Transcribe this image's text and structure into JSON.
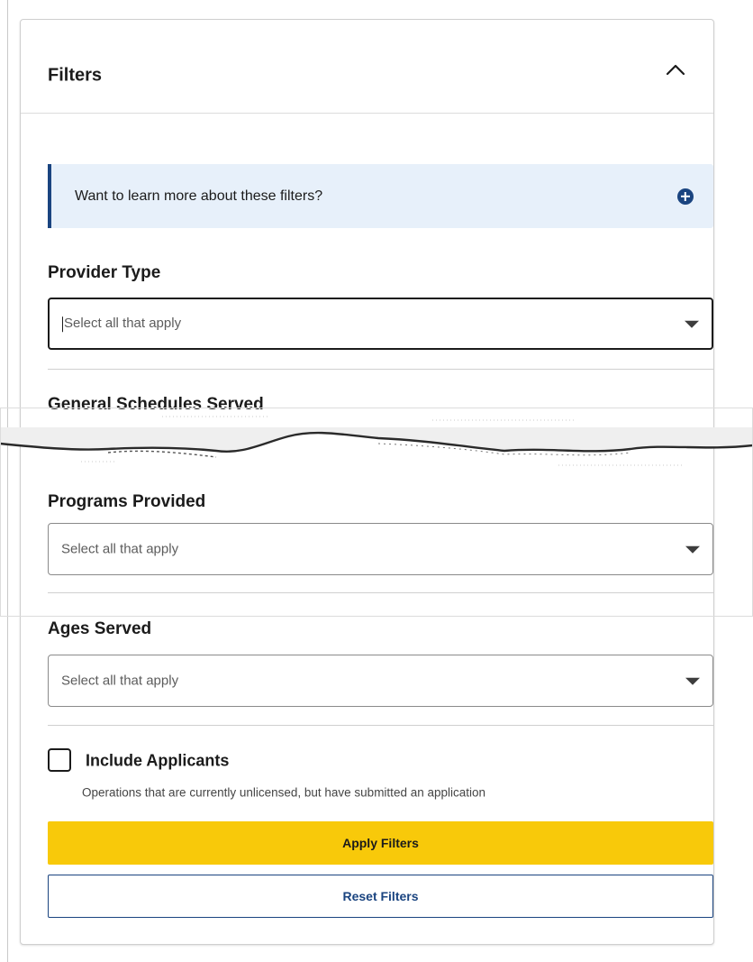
{
  "panel": {
    "title": "Filters",
    "collapse_icon": "chevron-up-icon"
  },
  "info": {
    "text": "Want to learn more about these filters?",
    "icon": "plus-circle-icon",
    "accent_color": "#1a4480"
  },
  "filters": {
    "provider_type": {
      "label": "Provider Type",
      "placeholder": "Select all that apply",
      "focused": true
    },
    "general_schedules": {
      "label": "General Schedules Served"
    },
    "programs": {
      "label": "Programs Provided",
      "placeholder": "Select all that apply"
    },
    "ages": {
      "label": "Ages Served",
      "placeholder": "Select all that apply"
    }
  },
  "applicants": {
    "label": "Include Applicants",
    "hint": "Operations that are currently unlicensed, but have submitted an application",
    "checked": false
  },
  "buttons": {
    "apply": "Apply Filters",
    "reset": "Reset Filters",
    "apply_color": "#f8c90a",
    "reset_color": "#1a4480"
  }
}
